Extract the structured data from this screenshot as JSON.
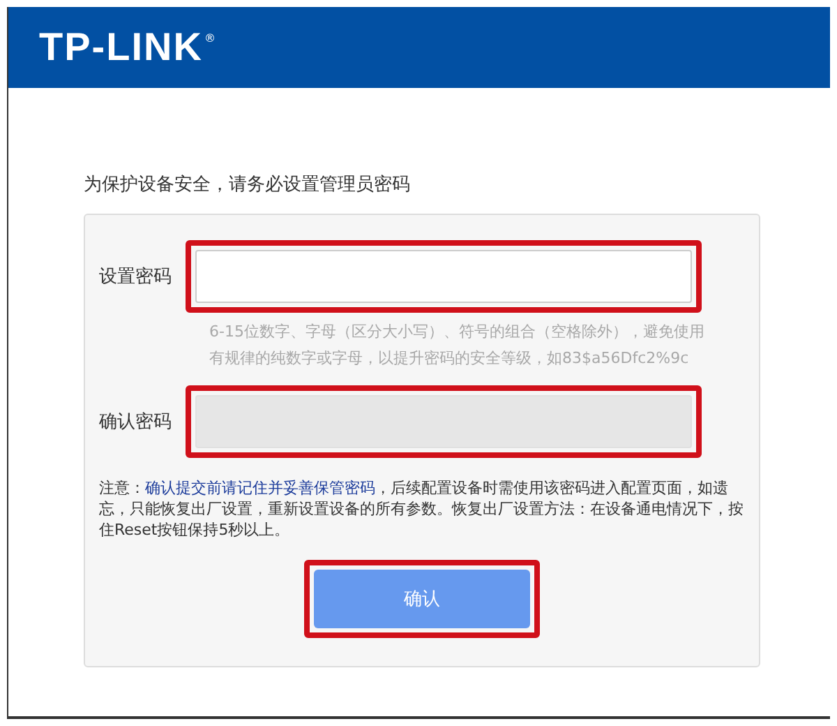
{
  "header": {
    "logo": "TP-LINK",
    "logo_mark": "®"
  },
  "title": "为保护设备安全，请务必设置管理员密码",
  "fields": [
    {
      "label": "设置密码",
      "disabled": false,
      "highlighted": true,
      "hint": "6-15位数字、字母（区分大小写）、符号的组合（空格除外），避免使用有规律的纯数字或字母，以提升密码的安全等级，如83$a56Dfc2%9c"
    },
    {
      "label": "确认密码",
      "disabled": true,
      "highlighted": true
    }
  ],
  "note": "注意：**确认提交前请记住并妥善保管密码**，后续配置设备时需使用该密码进入配置页面，如遗忘，只能恢复出厂设置，重新设置设备的所有参数。恢复出厂设置方法：在设备通电情况下，按住Reset按钮保持5秒以上。",
  "button": {
    "label": "确认",
    "highlighted": true
  }
}
